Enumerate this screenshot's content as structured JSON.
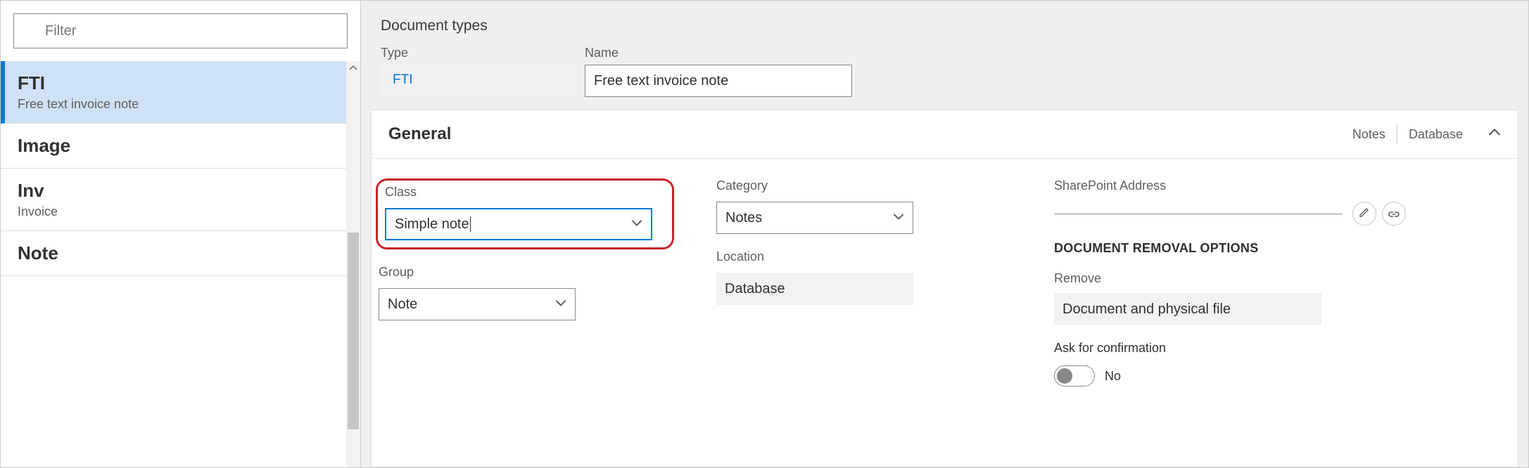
{
  "filter": {
    "placeholder": "Filter"
  },
  "sidebar": {
    "items": [
      {
        "title": "FTI",
        "subtitle": "Free text invoice note",
        "selected": true
      },
      {
        "title": "Image",
        "subtitle": ""
      },
      {
        "title": "Inv",
        "subtitle": "Invoice"
      },
      {
        "title": "Note",
        "subtitle": ""
      }
    ]
  },
  "page_title": "Document types",
  "header": {
    "type_label": "Type",
    "type_value": "FTI",
    "name_label": "Name",
    "name_value": "Free text invoice note"
  },
  "card": {
    "title": "General",
    "tag1": "Notes",
    "tag2": "Database",
    "col1": {
      "class_label": "Class",
      "class_value": "Simple note",
      "group_label": "Group",
      "group_value": "Note"
    },
    "col2": {
      "category_label": "Category",
      "category_value": "Notes",
      "location_label": "Location",
      "location_value": "Database"
    },
    "col3": {
      "sp_label": "SharePoint Address",
      "remove_heading": "DOCUMENT REMOVAL OPTIONS",
      "remove_label": "Remove",
      "remove_value": "Document and physical file",
      "confirm_label": "Ask for confirmation",
      "confirm_value": "No"
    }
  }
}
